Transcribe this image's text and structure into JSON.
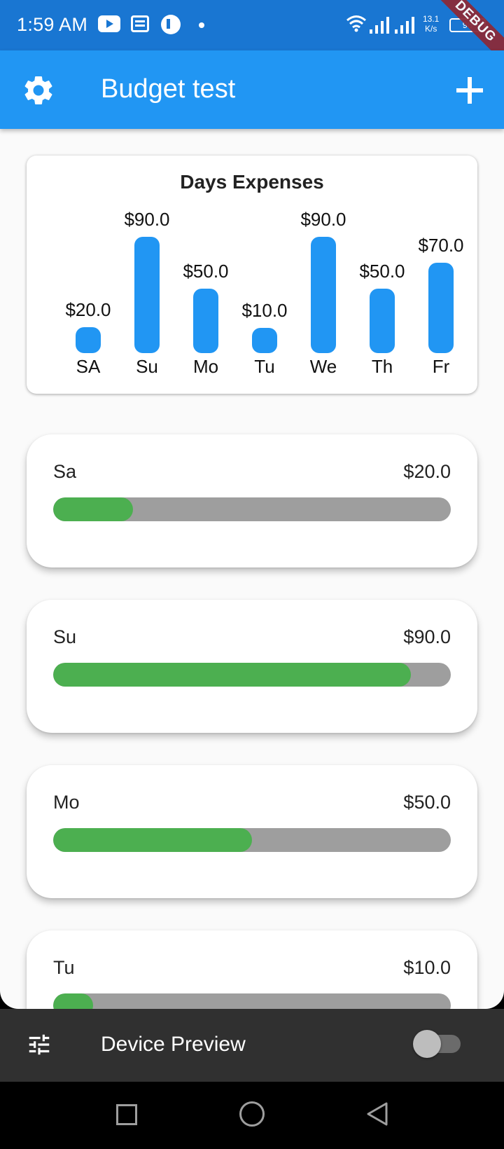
{
  "status_bar": {
    "time": "1:59 AM",
    "speed_value": "13.1",
    "speed_unit": "K/s",
    "battery": "98",
    "debug_label": "DEBUG",
    "icons": [
      "youtube-icon",
      "messages-icon",
      "pocket-casts-icon",
      "dot-icon",
      "wifi-icon",
      "signal-icon",
      "signal-icon",
      "battery-icon"
    ]
  },
  "app_bar": {
    "title": "Budget test",
    "left_icon": "gear-icon",
    "right_icon": "plus-icon",
    "color": "#2196f3"
  },
  "chart_data": {
    "type": "bar",
    "title": "Days Expenses",
    "categories": [
      "SA",
      "Su",
      "Mo",
      "Tu",
      "We",
      "Th",
      "Fr"
    ],
    "values": [
      20.0,
      90.0,
      50.0,
      10.0,
      90.0,
      50.0,
      70.0
    ],
    "value_labels": [
      "$20.0",
      "$90.0",
      "$50.0",
      "$10.0",
      "$90.0",
      "$50.0",
      "$70.0"
    ],
    "ylim": [
      0,
      90
    ],
    "grid": false,
    "bar_color": "#2196f3"
  },
  "day_list": [
    {
      "name": "Sa",
      "amount": "$20.0",
      "fraction": 0.2
    },
    {
      "name": "Su",
      "amount": "$90.0",
      "fraction": 0.9
    },
    {
      "name": "Mo",
      "amount": "$50.0",
      "fraction": 0.5
    },
    {
      "name": "Tu",
      "amount": "$10.0",
      "fraction": 0.1
    }
  ],
  "progress_colors": {
    "fill": "#4caf50",
    "track": "#9e9e9e"
  },
  "device_preview": {
    "label": "Device Preview",
    "icon": "tune-icon",
    "toggle_on": false
  },
  "nav_bar": {
    "icons": [
      "recents-square-icon",
      "home-circle-icon",
      "back-triangle-icon"
    ]
  }
}
